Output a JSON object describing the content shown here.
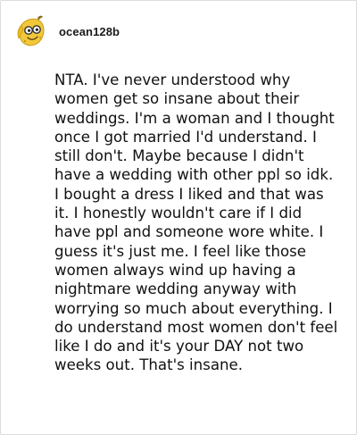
{
  "post": {
    "username": "ocean128b",
    "avatar_icon": "banana-avatar-icon",
    "comment_text": "NTA. I've never understood why women get so insane about their weddings. I'm a woman and I thought once I got married I'd understand. I still don't. Maybe because I didn't have a wedding with other ppl so idk. I bought a dress I liked and that was it. I honestly wouldn't care if I did have ppl and someone wore white. I guess it's just me. I feel like those women always wind up having a nightmare wedding anyway with worrying so much about everything. I do understand most women don't feel like I do and it's your DAY not two weeks out. That's insane."
  },
  "colors": {
    "avatar_yellow": "#f2c83a",
    "text": "#111111",
    "border": "#dcdcdc"
  }
}
